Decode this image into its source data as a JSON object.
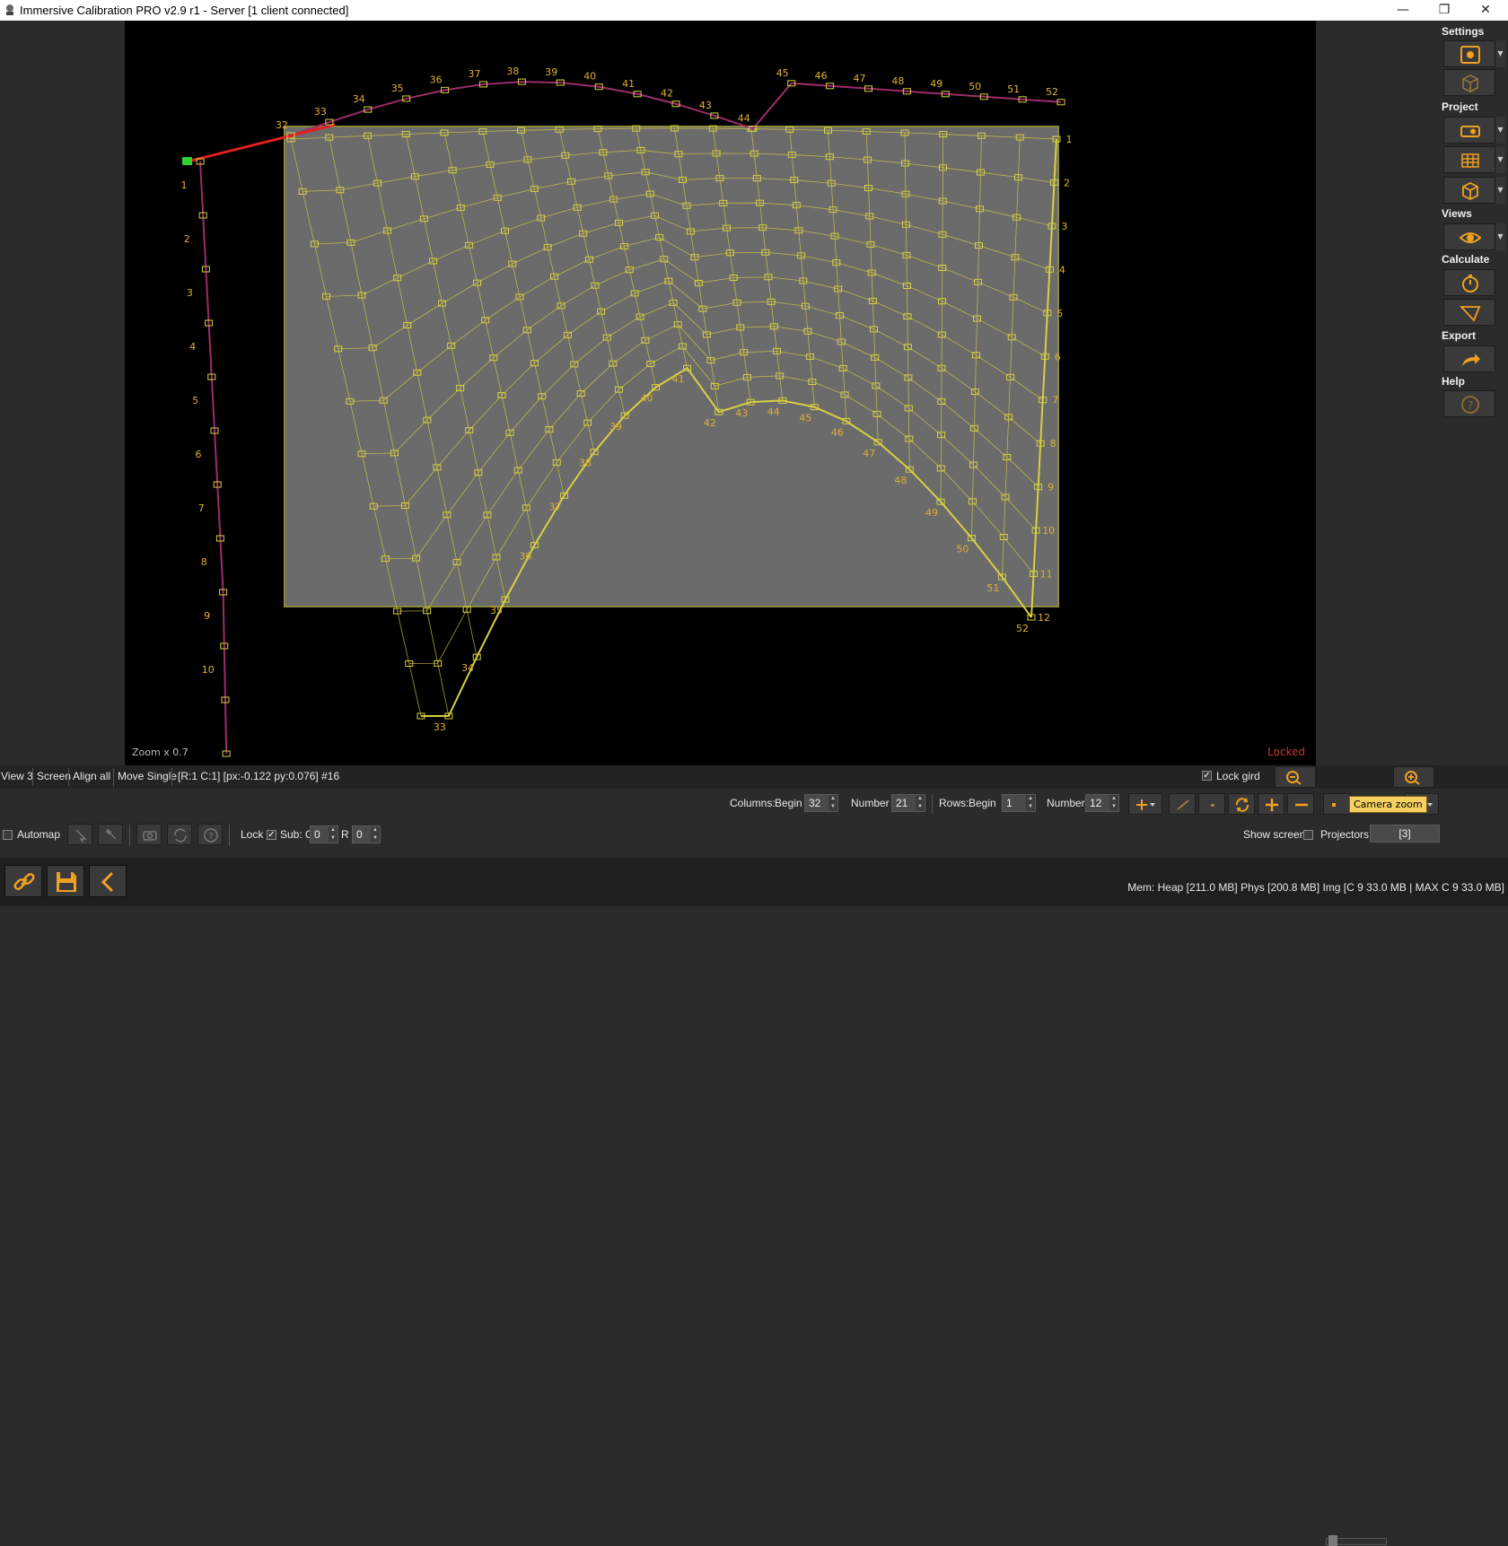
{
  "window": {
    "title": "Immersive Calibration PRO v2.9 r1 - Server [1 client connected]",
    "minimize": "—",
    "restore": "❐",
    "close": "✕"
  },
  "viewport": {
    "zoom_label": "Zoom x 0.7",
    "locked_label": "Locked",
    "top_labels": [
      "32",
      "33",
      "34",
      "35",
      "36",
      "37",
      "38",
      "39",
      "40",
      "41",
      "42",
      "43",
      "44",
      "45",
      "46",
      "47",
      "48",
      "49",
      "50",
      "51",
      "52"
    ],
    "bottom_labels": [
      "33",
      "34",
      "35",
      "36",
      "37",
      "38",
      "39",
      "40",
      "41",
      "42",
      "43",
      "44",
      "45",
      "46",
      "47",
      "48",
      "49",
      "50",
      "51",
      "52"
    ],
    "left_labels": [
      "1",
      "2",
      "3",
      "4",
      "5",
      "6",
      "7",
      "8",
      "9",
      "10"
    ],
    "right_labels": [
      "1",
      "2",
      "3",
      "4",
      "5",
      "6",
      "7",
      "8",
      "9",
      "10",
      "11",
      "12"
    ]
  },
  "right_panel": {
    "settings": "Settings",
    "project": "Project",
    "views": "Views",
    "calculate": "Calculate",
    "export": "Export",
    "help": "Help",
    "icons": [
      "settings-gear-icon",
      "grid-cube-icon",
      "projector-icon",
      "grid-mesh-icon",
      "cube-icon",
      "eye-icon",
      "stopwatch-icon",
      "frustum-icon",
      "export-arrow-icon",
      "help-icon"
    ]
  },
  "status": {
    "view": "View 3",
    "screen": "Screen",
    "align": "Align all",
    "move": "Move Single",
    "info": "[R:1 C:1] [px:-0.122 py:0.076] #16",
    "lock_grid": "Lock gird"
  },
  "grid_controls": {
    "columns_label": "Columns:",
    "begin_label": "Begin",
    "columns_begin": "32",
    "number_label": "Number",
    "columns_number": "21",
    "rows_label": "Rows:",
    "rows_begin": "1",
    "rows_number": "12",
    "tooltip": "Camera zoom"
  },
  "row3": {
    "automap": "Automap",
    "lock": "Lock",
    "sub_label": "Sub: C",
    "sub_c": "0",
    "r_label": "R",
    "sub_r": "0",
    "show_screen": "Show screen",
    "projectors": "Projectors",
    "projectors_value": "[3]"
  },
  "bottom": {
    "memory": "Mem: Heap [211.0 MB] Phys [200.8 MB] Img [C 9 33.0 MB | MAX C 9 33.0 MB]"
  },
  "colors": {
    "grid": "#d8d040",
    "label": "#e0b030",
    "border": "#9b2d6a",
    "accent": "#f0a020",
    "locked": "#c43a2f"
  }
}
